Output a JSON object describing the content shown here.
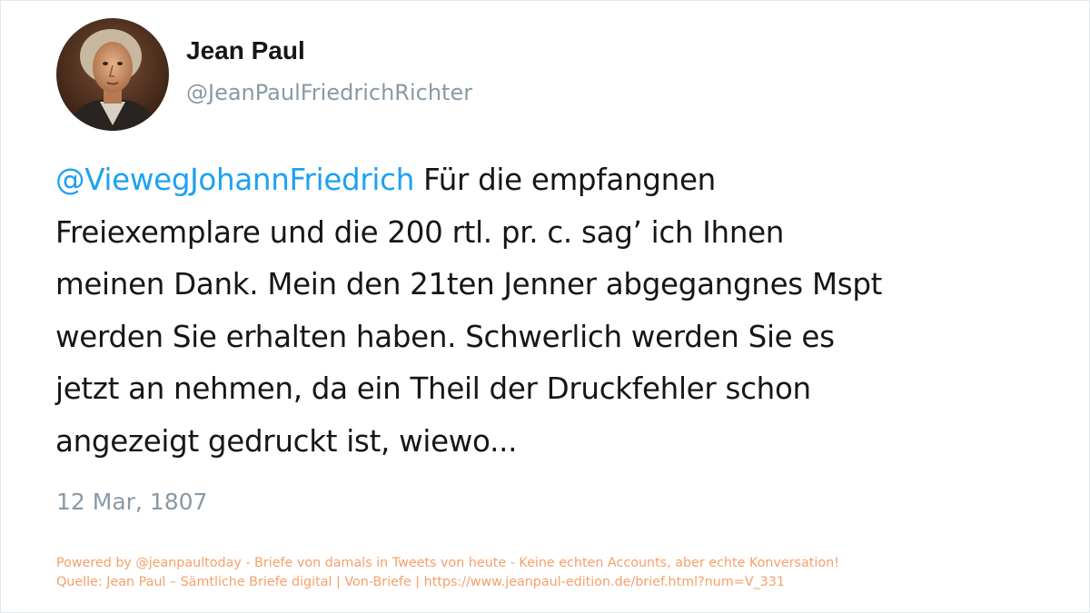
{
  "author": {
    "name": "Jean Paul",
    "handle": "@JeanPaulFriedrichRichter",
    "avatar_icon": "portrait-avatar"
  },
  "tweet": {
    "mention": "@ViewegJohannFriedrich",
    "lines": [
      " Für die empfangnen",
      "Freiexemplare und die 200 rtl. pr. c. sag’ ich Ihnen",
      "meinen Dank. Mein den 21ten Jenner abgegangnes Mspt",
      "werden Sie erhalten haben. Schwerlich werden Sie es",
      "jetzt an nehmen, da ein Theil der Druckfehler schon",
      "angezeigt gedruckt ist, wiewo..."
    ],
    "date": "12 Mar, 1807"
  },
  "footer": {
    "powered_by": "Powered by @jeanpaultoday - Briefe von damals in Tweets von heute - Keine echten Accounts, aber echte Konversation!",
    "source": "Quelle: Jean Paul – Sämtliche Briefe digital | Von-Briefe | https://www.jeanpaul-edition.de/brief.html?num=V_331"
  },
  "colors": {
    "text": "#14171a",
    "mention": "#1da1f2",
    "muted": "#8899a6",
    "footer": "#f5a06a"
  }
}
